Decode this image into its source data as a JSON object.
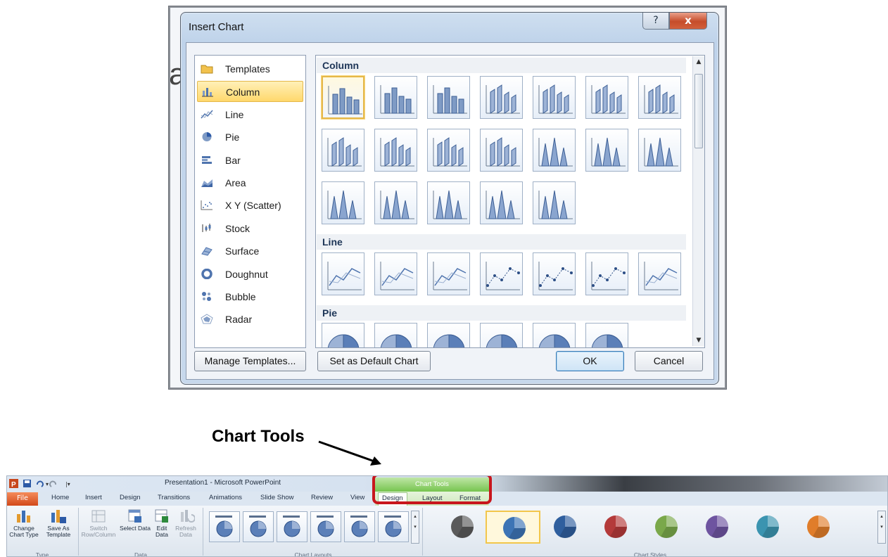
{
  "dialog": {
    "title": "Insert Chart",
    "help_label": "?",
    "close_label": "x",
    "types": [
      {
        "label": "Templates",
        "icon": "folder-icon"
      },
      {
        "label": "Column",
        "icon": "column-chart-icon"
      },
      {
        "label": "Line",
        "icon": "line-chart-icon"
      },
      {
        "label": "Pie",
        "icon": "pie-chart-icon"
      },
      {
        "label": "Bar",
        "icon": "bar-chart-icon"
      },
      {
        "label": "Area",
        "icon": "area-chart-icon"
      },
      {
        "label": "X Y (Scatter)",
        "icon": "scatter-chart-icon"
      },
      {
        "label": "Stock",
        "icon": "stock-chart-icon"
      },
      {
        "label": "Surface",
        "icon": "surface-chart-icon"
      },
      {
        "label": "Doughnut",
        "icon": "doughnut-chart-icon"
      },
      {
        "label": "Bubble",
        "icon": "bubble-chart-icon"
      },
      {
        "label": "Radar",
        "icon": "radar-chart-icon"
      }
    ],
    "selected_type": "Column",
    "sections": {
      "column": "Column",
      "line": "Line",
      "pie": "Pie"
    },
    "buttons": {
      "manage_templates": "Manage Templates...",
      "set_default": "Set as Default Chart",
      "ok": "OK",
      "cancel": "Cancel"
    }
  },
  "annotation": {
    "label": "Chart Tools"
  },
  "ribbon": {
    "app_title": "Presentation1 - Microsoft PowerPoint",
    "tabs": [
      "File",
      "Home",
      "Insert",
      "Design",
      "Transitions",
      "Animations",
      "Slide Show",
      "Review",
      "View"
    ],
    "context_header": "Chart Tools",
    "context_tabs": [
      "Design",
      "Layout",
      "Format"
    ],
    "buttons": {
      "change_chart_type": "Change Chart Type",
      "save_as_template": "Save As Template",
      "switch_row_column": "Switch Row/Column",
      "select_data": "Select Data",
      "edit_data": "Edit Data",
      "refresh_data": "Refresh Data"
    },
    "groups": {
      "type": "Type",
      "data": "Data",
      "chart_layouts": "Chart Layouts",
      "chart_styles": "Chart Styles"
    },
    "style_colors": [
      "#5a5a5a",
      "#3d74b5",
      "#2f5f9e",
      "#b43a3a",
      "#7aa84a",
      "#6e54a0",
      "#3b94b0",
      "#e07d2a"
    ],
    "accent_red": "#c8161d",
    "context_green": "#76c44f"
  }
}
